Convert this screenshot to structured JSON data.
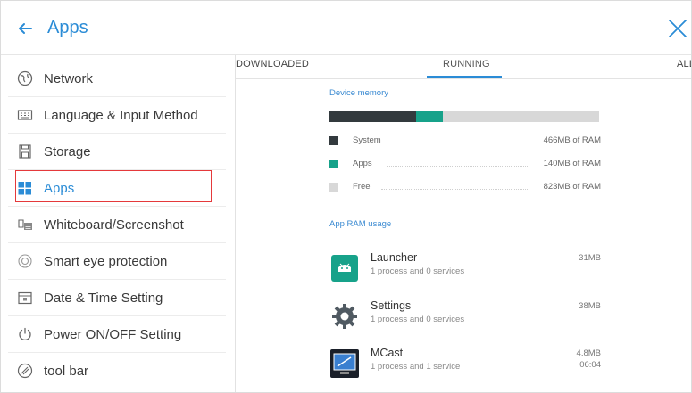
{
  "header": {
    "title": "Apps",
    "back_icon": "arrow-left-icon",
    "close_icon": "close-icon",
    "accent": "#2b8cd6"
  },
  "sidebar": {
    "selected_index": 3,
    "items": [
      {
        "label": "Network",
        "icon": "globe-icon"
      },
      {
        "label": "Language & Input Method",
        "icon": "keyboard-icon"
      },
      {
        "label": "Storage",
        "icon": "storage-icon"
      },
      {
        "label": "Apps",
        "icon": "apps-grid-icon"
      },
      {
        "label": "Whiteboard/Screenshot",
        "icon": "whiteboard-icon"
      },
      {
        "label": "Smart eye protection",
        "icon": "eye-icon"
      },
      {
        "label": "Date & Time Setting",
        "icon": "calendar-icon"
      },
      {
        "label": "Power ON/OFF Setting",
        "icon": "power-icon"
      },
      {
        "label": "tool bar",
        "icon": "toolbar-icon"
      }
    ]
  },
  "tabs": {
    "items": [
      {
        "label": "DOWNLOADED"
      },
      {
        "label": "RUNNING"
      },
      {
        "label": "ALL"
      }
    ],
    "active": "RUNNING"
  },
  "memory": {
    "section_title": "Device memory",
    "usage_fractions": {
      "system": 0.32,
      "apps": 0.1,
      "free": 0.58
    },
    "legend": [
      {
        "name": "System",
        "value": "466MB of RAM",
        "color": "#333a3e"
      },
      {
        "name": "Apps",
        "value": "140MB of RAM",
        "color": "#17a28a"
      },
      {
        "name": "Free",
        "value": "823MB of RAM",
        "color": "#d8d8d8"
      }
    ]
  },
  "app_ram": {
    "section_title": "App RAM usage",
    "apps": [
      {
        "name": "Launcher",
        "detail": "1 process and 0 services",
        "size": "31MB",
        "time": "",
        "icon": "launcher-icon"
      },
      {
        "name": "Settings",
        "detail": "1 process and 0 services",
        "size": "38MB",
        "time": "",
        "icon": "settings-gear-icon"
      },
      {
        "name": "MCast",
        "detail": "1 process and 1 service",
        "size": "4.8MB",
        "time": "06:04",
        "icon": "mcast-icon"
      }
    ]
  }
}
